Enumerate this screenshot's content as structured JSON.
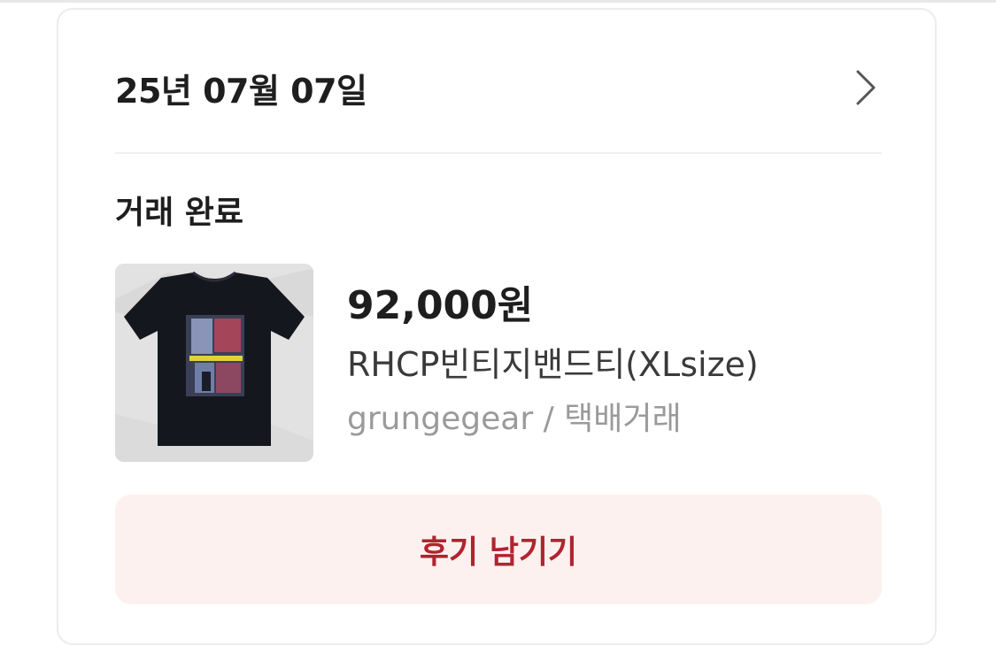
{
  "order": {
    "date": "25년 07월 07일",
    "status": "거래 완료",
    "price": "92,000원",
    "product_name": "RHCP빈티지밴드티(XLsize)",
    "seller_and_method": "grungegear / 택배거래",
    "thumbnail_icon": "tshirt-photo"
  },
  "actions": {
    "review_label": "후기 남기기",
    "detail_icon": "chevron-right-icon"
  },
  "colors": {
    "accent": "#b0242f",
    "button_bg": "#fdf1f0",
    "text_primary": "#1e1e1e",
    "text_secondary": "#9a9a9a"
  }
}
